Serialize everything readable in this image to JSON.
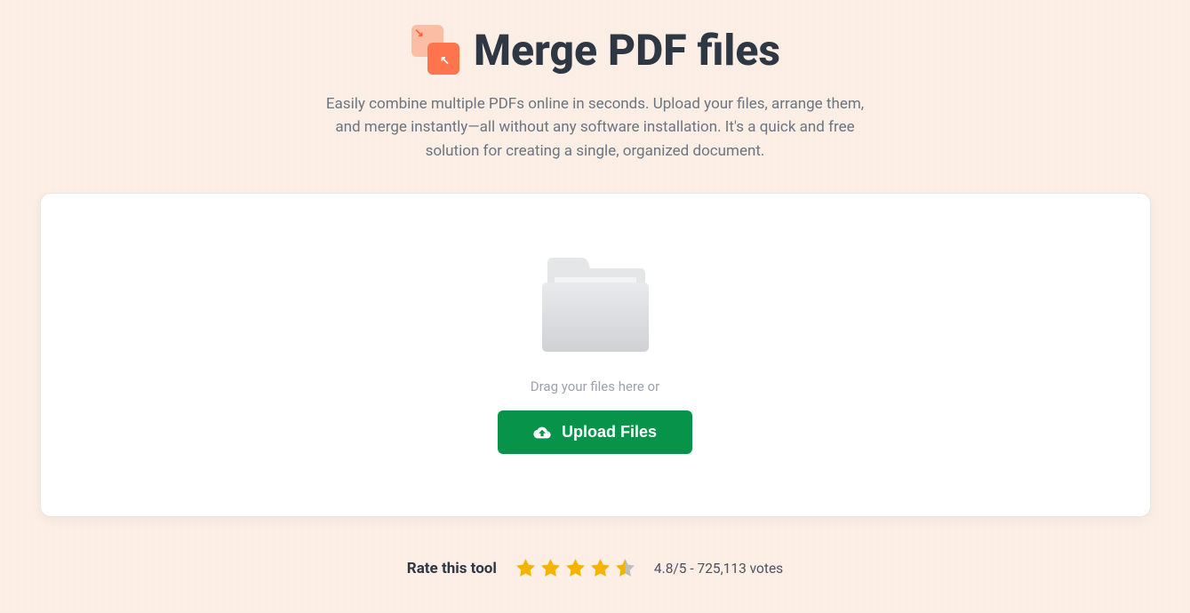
{
  "hero": {
    "title": "Merge PDF files",
    "subtitle": "Easily combine multiple PDFs online in seconds. Upload your files, arrange them, and merge instantly—all without any software installation. It's a quick and free solution for creating a single, organized document."
  },
  "dropzone": {
    "drag_text": "Drag your files here or",
    "upload_label": "Upload Files"
  },
  "rating": {
    "label": "Rate this tool",
    "value_text": "4.8/5 - 725,113 votes"
  }
}
